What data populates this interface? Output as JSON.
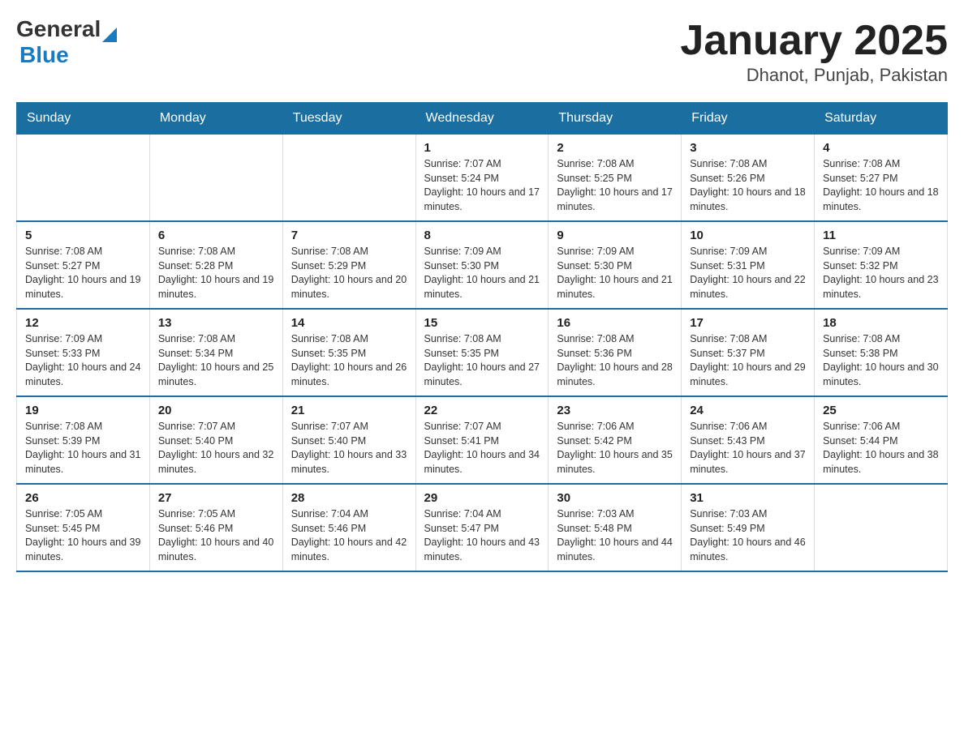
{
  "header": {
    "logo_general": "General",
    "logo_blue": "Blue",
    "title": "January 2025",
    "subtitle": "Dhanot, Punjab, Pakistan"
  },
  "weekdays": [
    "Sunday",
    "Monday",
    "Tuesday",
    "Wednesday",
    "Thursday",
    "Friday",
    "Saturday"
  ],
  "weeks": [
    [
      {
        "day": "",
        "info": ""
      },
      {
        "day": "",
        "info": ""
      },
      {
        "day": "",
        "info": ""
      },
      {
        "day": "1",
        "info": "Sunrise: 7:07 AM\nSunset: 5:24 PM\nDaylight: 10 hours and 17 minutes."
      },
      {
        "day": "2",
        "info": "Sunrise: 7:08 AM\nSunset: 5:25 PM\nDaylight: 10 hours and 17 minutes."
      },
      {
        "day": "3",
        "info": "Sunrise: 7:08 AM\nSunset: 5:26 PM\nDaylight: 10 hours and 18 minutes."
      },
      {
        "day": "4",
        "info": "Sunrise: 7:08 AM\nSunset: 5:27 PM\nDaylight: 10 hours and 18 minutes."
      }
    ],
    [
      {
        "day": "5",
        "info": "Sunrise: 7:08 AM\nSunset: 5:27 PM\nDaylight: 10 hours and 19 minutes."
      },
      {
        "day": "6",
        "info": "Sunrise: 7:08 AM\nSunset: 5:28 PM\nDaylight: 10 hours and 19 minutes."
      },
      {
        "day": "7",
        "info": "Sunrise: 7:08 AM\nSunset: 5:29 PM\nDaylight: 10 hours and 20 minutes."
      },
      {
        "day": "8",
        "info": "Sunrise: 7:09 AM\nSunset: 5:30 PM\nDaylight: 10 hours and 21 minutes."
      },
      {
        "day": "9",
        "info": "Sunrise: 7:09 AM\nSunset: 5:30 PM\nDaylight: 10 hours and 21 minutes."
      },
      {
        "day": "10",
        "info": "Sunrise: 7:09 AM\nSunset: 5:31 PM\nDaylight: 10 hours and 22 minutes."
      },
      {
        "day": "11",
        "info": "Sunrise: 7:09 AM\nSunset: 5:32 PM\nDaylight: 10 hours and 23 minutes."
      }
    ],
    [
      {
        "day": "12",
        "info": "Sunrise: 7:09 AM\nSunset: 5:33 PM\nDaylight: 10 hours and 24 minutes."
      },
      {
        "day": "13",
        "info": "Sunrise: 7:08 AM\nSunset: 5:34 PM\nDaylight: 10 hours and 25 minutes."
      },
      {
        "day": "14",
        "info": "Sunrise: 7:08 AM\nSunset: 5:35 PM\nDaylight: 10 hours and 26 minutes."
      },
      {
        "day": "15",
        "info": "Sunrise: 7:08 AM\nSunset: 5:35 PM\nDaylight: 10 hours and 27 minutes."
      },
      {
        "day": "16",
        "info": "Sunrise: 7:08 AM\nSunset: 5:36 PM\nDaylight: 10 hours and 28 minutes."
      },
      {
        "day": "17",
        "info": "Sunrise: 7:08 AM\nSunset: 5:37 PM\nDaylight: 10 hours and 29 minutes."
      },
      {
        "day": "18",
        "info": "Sunrise: 7:08 AM\nSunset: 5:38 PM\nDaylight: 10 hours and 30 minutes."
      }
    ],
    [
      {
        "day": "19",
        "info": "Sunrise: 7:08 AM\nSunset: 5:39 PM\nDaylight: 10 hours and 31 minutes."
      },
      {
        "day": "20",
        "info": "Sunrise: 7:07 AM\nSunset: 5:40 PM\nDaylight: 10 hours and 32 minutes."
      },
      {
        "day": "21",
        "info": "Sunrise: 7:07 AM\nSunset: 5:40 PM\nDaylight: 10 hours and 33 minutes."
      },
      {
        "day": "22",
        "info": "Sunrise: 7:07 AM\nSunset: 5:41 PM\nDaylight: 10 hours and 34 minutes."
      },
      {
        "day": "23",
        "info": "Sunrise: 7:06 AM\nSunset: 5:42 PM\nDaylight: 10 hours and 35 minutes."
      },
      {
        "day": "24",
        "info": "Sunrise: 7:06 AM\nSunset: 5:43 PM\nDaylight: 10 hours and 37 minutes."
      },
      {
        "day": "25",
        "info": "Sunrise: 7:06 AM\nSunset: 5:44 PM\nDaylight: 10 hours and 38 minutes."
      }
    ],
    [
      {
        "day": "26",
        "info": "Sunrise: 7:05 AM\nSunset: 5:45 PM\nDaylight: 10 hours and 39 minutes."
      },
      {
        "day": "27",
        "info": "Sunrise: 7:05 AM\nSunset: 5:46 PM\nDaylight: 10 hours and 40 minutes."
      },
      {
        "day": "28",
        "info": "Sunrise: 7:04 AM\nSunset: 5:46 PM\nDaylight: 10 hours and 42 minutes."
      },
      {
        "day": "29",
        "info": "Sunrise: 7:04 AM\nSunset: 5:47 PM\nDaylight: 10 hours and 43 minutes."
      },
      {
        "day": "30",
        "info": "Sunrise: 7:03 AM\nSunset: 5:48 PM\nDaylight: 10 hours and 44 minutes."
      },
      {
        "day": "31",
        "info": "Sunrise: 7:03 AM\nSunset: 5:49 PM\nDaylight: 10 hours and 46 minutes."
      },
      {
        "day": "",
        "info": ""
      }
    ]
  ]
}
